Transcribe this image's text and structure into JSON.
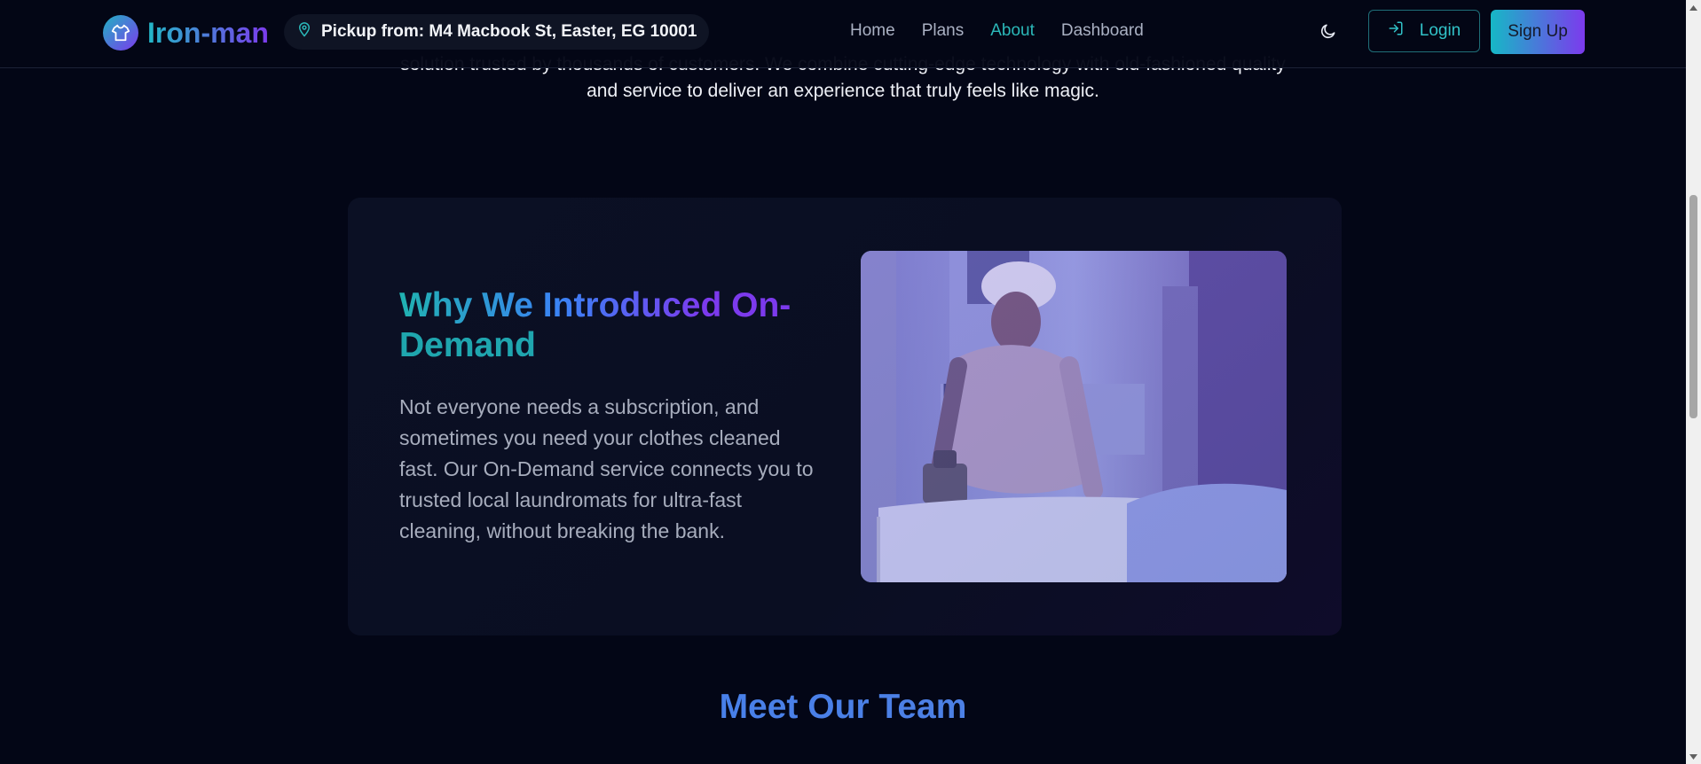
{
  "brand": {
    "name": "Iron-man",
    "logo_icon": "shirt-icon"
  },
  "pickup": {
    "icon": "map-pin-icon",
    "text": "Pickup from: M4 Macbook St, Easter, EG 10001"
  },
  "nav": {
    "links": [
      {
        "label": "Home",
        "active": false
      },
      {
        "label": "Plans",
        "active": false
      },
      {
        "label": "About",
        "active": true
      },
      {
        "label": "Dashboard",
        "active": false
      }
    ],
    "theme_icon": "moon-icon",
    "login_label": "Login",
    "login_icon": "login-arrow-icon",
    "signup_label": "Sign Up"
  },
  "intro": {
    "line1": "solution trusted by thousands of customers. We combine cutting-edge technology with old-fashioned quality",
    "line2": "and service to deliver an experience that truly feels like magic."
  },
  "feature": {
    "title_line1": "Why We Introduced On-",
    "title_line2": "Demand",
    "body": "Not everyone needs a subscription, and sometimes you need your clothes cleaned fast. Our On-Demand service connects you to trusted local laundromats for ultra-fast cleaning, without breaking the bank.",
    "image_alt": "Man ironing clothes with a traditional iron"
  },
  "team": {
    "title": "Meet Our Team"
  },
  "colors": {
    "background": "#030616",
    "accent_teal": "#2bb8b9",
    "accent_purple": "#7c3aed",
    "card_bg": "#0b1024"
  }
}
